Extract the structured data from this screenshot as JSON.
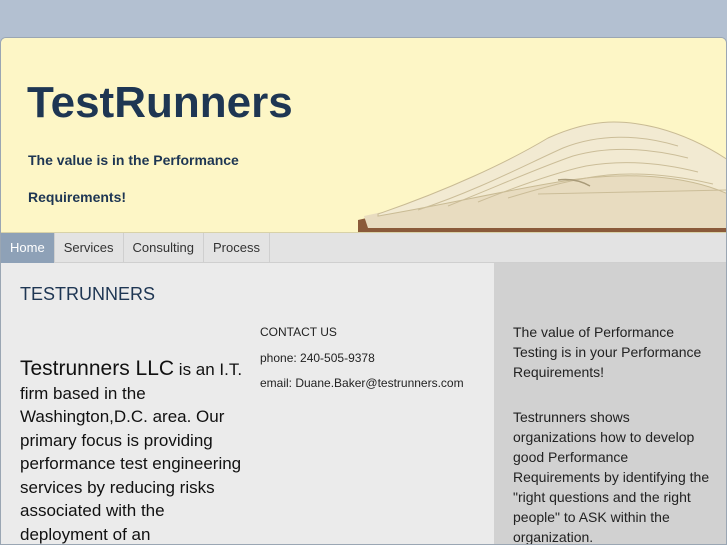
{
  "header": {
    "site_title": "TestRunners",
    "tagline": "The value is in the Performance Requirements!"
  },
  "nav": {
    "items": [
      {
        "label": "Home",
        "active": true
      },
      {
        "label": "Services"
      },
      {
        "label": "Consulting"
      },
      {
        "label": "Process"
      }
    ]
  },
  "main": {
    "section_title": "TESTRUNNERS",
    "company_name": "Testrunners LLC",
    "intro_text": " is an I.T. firm based in the Washington,D.C. area. Our primary focus is providing performance test engineering services by reducing risks associated with the deployment of an",
    "contact": {
      "heading": "CONTACT US",
      "phone": "phone: 240-505-9378",
      "email": "email: Duane.Baker@testrunners.com"
    }
  },
  "sidebar": {
    "paragraphs": [
      "The value of Performance Testing is in your Performance Requirements!",
      "Testrunners shows organizations how to develop good Performance Requirements by identifying the \"right questions and the right people\" to ASK within the organization."
    ]
  },
  "colors": {
    "header_bg": "#fdf6c6",
    "title_color": "#1e3653",
    "nav_active": "#8ea1b7",
    "sidebar_bg": "#d1d1d1",
    "page_bg": "#b3c0d1"
  }
}
